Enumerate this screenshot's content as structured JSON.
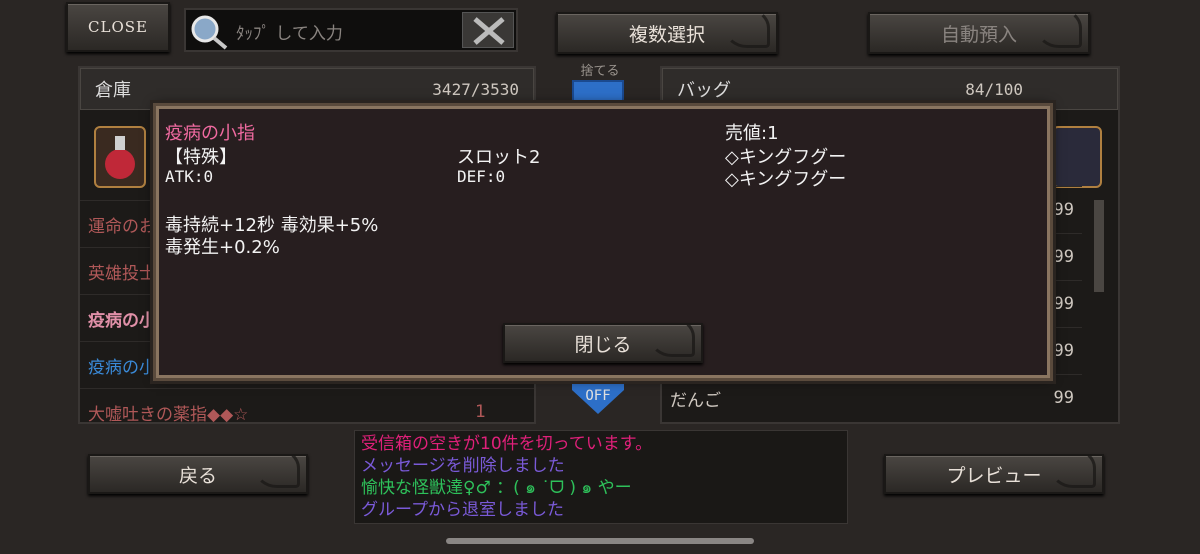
{
  "top": {
    "close": "CLOSE",
    "search_placeholder": "ﾀｯﾌﾟ して入力",
    "multi_select": "複数選択",
    "auto_deposit": "自動預入",
    "discard": "捨てる"
  },
  "warehouse": {
    "title": "倉庫",
    "count": "3427/3530",
    "items": [
      {
        "name": "運命のお",
        "qty": ""
      },
      {
        "name": "英雄投士",
        "qty": ""
      },
      {
        "name": "疫病の小",
        "qty": ""
      },
      {
        "name": "疫病の小",
        "qty": ""
      },
      {
        "name": "大嘘吐きの薬指◆◆☆",
        "qty": "1"
      }
    ]
  },
  "bag": {
    "title": "バッグ",
    "count": "84/100",
    "items": [
      {
        "name": "",
        "qty": "99"
      },
      {
        "name": "",
        "qty": "99"
      },
      {
        "name": "",
        "qty": "99"
      },
      {
        "name": "",
        "qty": "99"
      },
      {
        "name": "だんご",
        "qty": "99"
      }
    ]
  },
  "toggle": "OFF",
  "dialog": {
    "name": "疫病の小指",
    "type": "【特殊】",
    "slot": "スロット2",
    "sell": "売値:1",
    "monster1": "◇キングフグー",
    "monster2": "◇キングフグー",
    "atk": "ATK:0",
    "def": "DEF:0",
    "effect1": "毒持続+12秒 毒効果+5%",
    "effect2": "毒発生+0.2%",
    "close_btn": "閉じる"
  },
  "messages": [
    {
      "text": "受信箱の空きが10件を切っています。",
      "color": "#e0207a"
    },
    {
      "text": "メッセージを削除しました",
      "color": "#7a5ad8"
    },
    {
      "text": "愉快な怪獣達♀♂ ：( ๑ ˙ᗜ ) ๑  やー",
      "color": "#2ec05a"
    },
    {
      "text": "グループから退室しました",
      "color": "#7a5ad8"
    }
  ],
  "bottom": {
    "back": "戻る",
    "preview": "プレビュー"
  },
  "colors": {
    "pink": "#f06aa0",
    "dialog_border": "#8a7560"
  }
}
